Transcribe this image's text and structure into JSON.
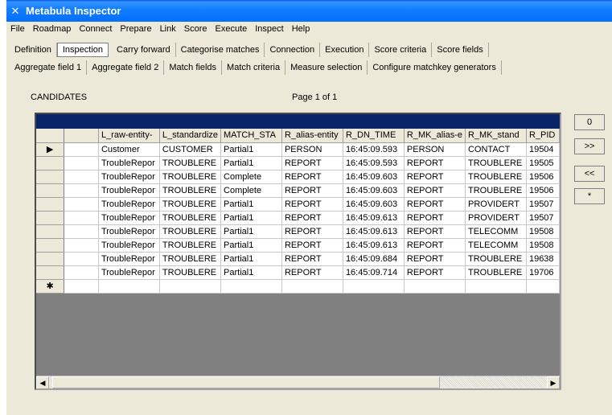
{
  "window": {
    "title": "Metabula Inspector",
    "icon": "app-icon"
  },
  "menu": [
    "File",
    "Roadmap",
    "Connect",
    "Prepare",
    "Link",
    "Score",
    "Execute",
    "Inspect",
    "Help"
  ],
  "tabs_row1": [
    "Definition",
    "Inspection",
    "Carry forward",
    "Categorise matches",
    "Connection",
    "Execution",
    "Score criteria",
    "Score fields"
  ],
  "tabs_row2": [
    "Aggregate field 1",
    "Aggregate field 2",
    "Match fields",
    "Match criteria",
    "Measure selection",
    "Configure matchkey generators"
  ],
  "active_tab": "Inspection",
  "candidates": {
    "label": "CANDIDATES",
    "page": "Page 1 of 1"
  },
  "grid": {
    "columns": [
      "",
      "L_raw-entity-",
      "L_standardize",
      "MATCH_STA",
      "R_alias-entity",
      "R_DN_TIME",
      "R_MK_alias-e",
      "R_MK_stand",
      "R_PID"
    ],
    "rows": [
      [
        "",
        "Customer",
        "CUSTOMER",
        "Partial1",
        "PERSON",
        "16:45:09.593",
        "PERSON",
        "CONTACT",
        "19504"
      ],
      [
        "",
        "TroubleRepor",
        "TROUBLERE",
        "Partial1",
        "REPORT",
        "16:45:09.593",
        "REPORT",
        "TROUBLERE",
        "19505"
      ],
      [
        "",
        "TroubleRepor",
        "TROUBLERE",
        "Complete",
        "REPORT",
        "16:45:09.603",
        "REPORT",
        "TROUBLERE",
        "19506"
      ],
      [
        "",
        "TroubleRepor",
        "TROUBLERE",
        "Complete",
        "REPORT",
        "16:45:09.603",
        "REPORT",
        "TROUBLERE",
        "19506"
      ],
      [
        "",
        "TroubleRepor",
        "TROUBLERE",
        "Partial1",
        "REPORT",
        "16:45:09.603",
        "REPORT",
        "PROVIDERT",
        "19507"
      ],
      [
        "",
        "TroubleRepor",
        "TROUBLERE",
        "Partial1",
        "REPORT",
        "16:45:09.613",
        "REPORT",
        "PROVIDERT",
        "19507"
      ],
      [
        "",
        "TroubleRepor",
        "TROUBLERE",
        "Partial1",
        "REPORT",
        "16:45:09.613",
        "REPORT",
        "TELECOMM",
        "19508"
      ],
      [
        "",
        "TroubleRepor",
        "TROUBLERE",
        "Partial1",
        "REPORT",
        "16:45:09.613",
        "REPORT",
        "TELECOMM",
        "19508"
      ],
      [
        "",
        "TroubleRepor",
        "TROUBLERE",
        "Partial1",
        "REPORT",
        "16:45:09.684",
        "REPORT",
        "TROUBLERE",
        "19638"
      ],
      [
        "",
        "TroubleRepor",
        "TROUBLERE",
        "Partial1",
        "REPORT",
        "16:45:09.714",
        "REPORT",
        "TROUBLERE",
        "19706"
      ]
    ],
    "current_row_marker": "▶",
    "new_row_marker": "✱"
  },
  "side_buttons": [
    "0",
    ">>",
    "<<",
    "*"
  ],
  "colors": {
    "title_bar": "#0058e6",
    "grid_caption": "#0a246a",
    "window_bg": "#ece9d8"
  }
}
